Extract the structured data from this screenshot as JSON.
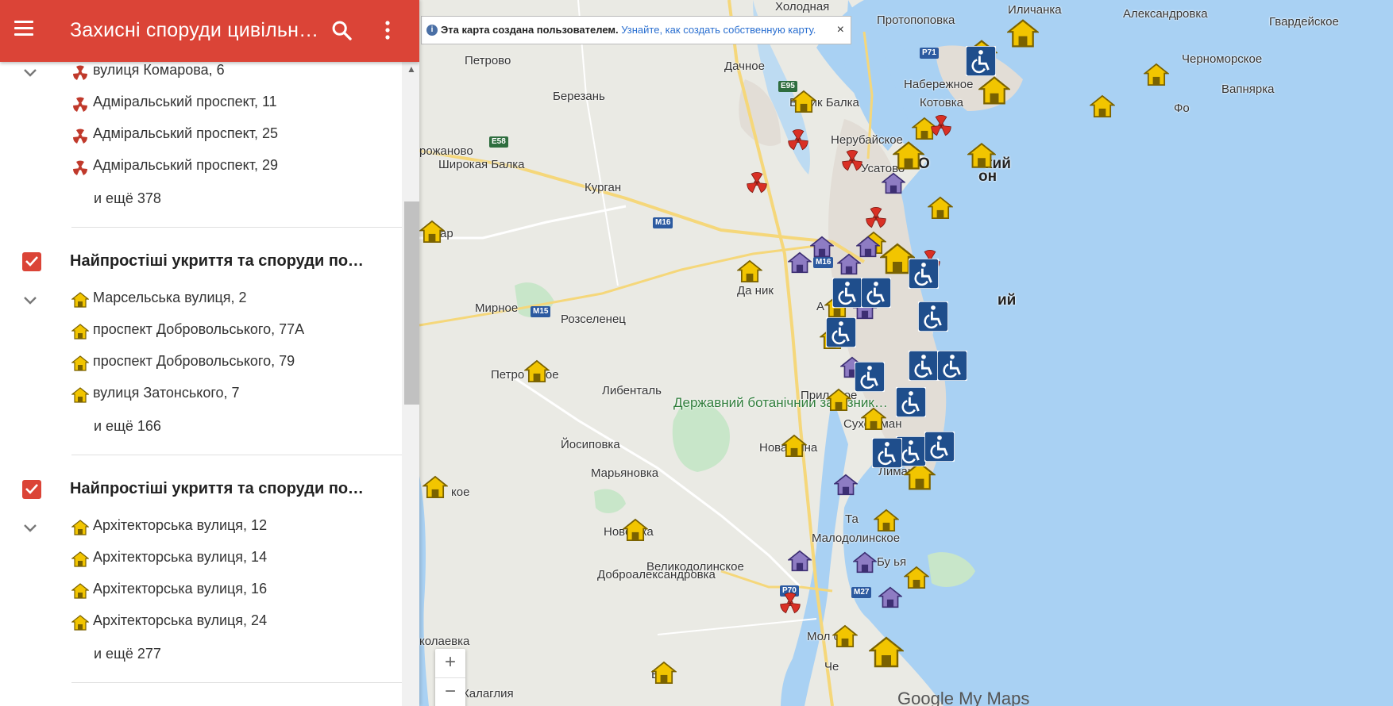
{
  "app": {
    "title": "Захисні споруди цивільн…"
  },
  "layers": [
    {
      "title": "",
      "items": [
        {
          "label": "вулиця Комарова, 6",
          "icon": "radiation-icon"
        },
        {
          "label": "Адміральський проспект, 11",
          "icon": "radiation-icon"
        },
        {
          "label": "Адміральський проспект, 25",
          "icon": "radiation-icon"
        },
        {
          "label": "Адміральський проспект, 29",
          "icon": "radiation-icon"
        }
      ],
      "more": "и ещё 378"
    },
    {
      "title": "Найпростіші укриття та споруди подві…",
      "items": [
        {
          "label": "Марсельська вулиця, 2",
          "icon": "shelter-icon"
        },
        {
          "label": "проспект Добровольського, 77А",
          "icon": "shelter-icon"
        },
        {
          "label": "проспект Добровольського, 79",
          "icon": "shelter-icon"
        },
        {
          "label": "вулиця Затонського, 7",
          "icon": "shelter-icon"
        }
      ],
      "more": "и ещё 166"
    },
    {
      "title": "Найпростіші укриття та споруди подві…",
      "items": [
        {
          "label": "Архітекторська вулиця, 12",
          "icon": "shelter-icon"
        },
        {
          "label": "Архітекторська вулиця, 14",
          "icon": "shelter-icon"
        },
        {
          "label": "Архітекторська вулиця, 16",
          "icon": "shelter-icon"
        },
        {
          "label": "Архітекторська вулиця, 24",
          "icon": "shelter-icon"
        }
      ],
      "more": "и ещё 277"
    }
  ],
  "map": {
    "info": {
      "message": "Эта карта создана пользователем.",
      "link": "Узнайте, как создать собственную карту.",
      "close": "×"
    },
    "zoom_in": "+",
    "zoom_out": "−",
    "brand_google": "Google",
    "brand_mymaps": "My Maps",
    "places": {
      "holodnaya": "Холодная",
      "ilichanka": "Иличанка",
      "aleksandrovka": "Александровка",
      "gvardeyskoe": "Гвардейское",
      "protopopovka": "Протопоповка",
      "chernomorskoe": "Черноморское",
      "petrovo": "Петрово",
      "dachnoe": "Дачное",
      "naberezhnoe": "Набережное",
      "vapnyarka": "Вапнярка",
      "berezan": "Березань",
      "velikaya_balka": "Велик Балка",
      "kotovka": "Котовка",
      "fontanka": "Фо",
      "nerubayskoe": "Нерубайское",
      "rozhanovo": "рожаново",
      "shirokaya_balka": "Широкая Балка",
      "usatovo": "Усатово",
      "kurgan": "Курган",
      "odesa_part1": "О",
      "odesa_part2": "кий",
      "odesa_part3": "он",
      "mar": "ар",
      "mirnoe": "Мирное",
      "rozselenets": "Розселенец",
      "dalnik": "Да ник",
      "b_letter": "Б",
      "a_letter": "А",
      "kiy2": "ий",
      "petrovskoe": "Петро нское",
      "libental": "Либенталь",
      "reserve": "Державний ботанічний заказник…",
      "prilimanskoe": "Прил ское",
      "suho_liman": "Сухо иман",
      "yosipovka": "Йосиповка",
      "novaya_dolina": "Нова лина",
      "maryanovka": "Марьяновка",
      "limanka": "Лиманка",
      "koe": "кое",
      "novo_vka": "Ново вка",
      "ta": "Та",
      "malodolinskoe": "Малодолинское",
      "velikodolinskoe": "Великодолинское",
      "dobroaleksandrovka": "Доброалександровка",
      "bunya": "Бу ья",
      "moloe": "Мол ое",
      "kolaevka": "колаевка",
      "che": "Че",
      "ba": "Ба",
      "kalagliya": "Калаглия"
    },
    "roads": {
      "e95": "E95",
      "e58": "E58",
      "p71": "P71",
      "m16a": "M16",
      "m16b": "M16",
      "m15": "M15",
      "p70": "P70",
      "m27": "M27"
    }
  }
}
